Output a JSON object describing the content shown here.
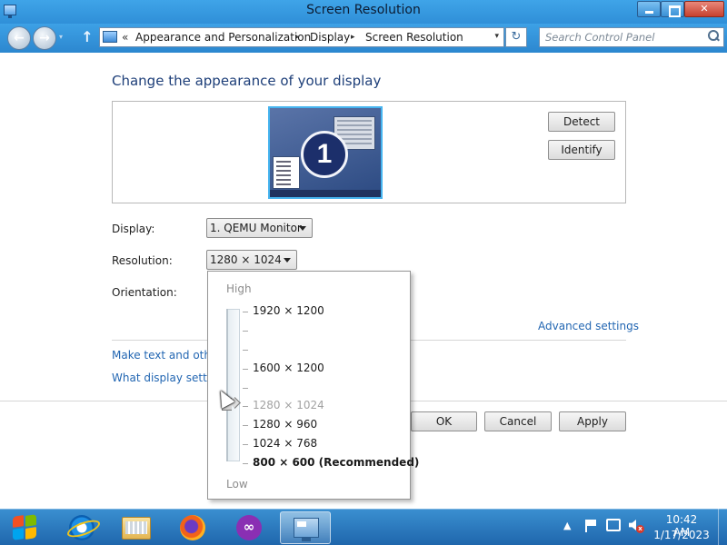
{
  "window": {
    "title": "Screen Resolution",
    "minimize": "",
    "maximize": "",
    "close": "✕"
  },
  "navigation": {
    "back": "←",
    "forward": "→",
    "up": "↑",
    "breadcrumb_lead": "«",
    "breadcrumb": [
      "Appearance and Personalization",
      "Display",
      "Screen Resolution"
    ],
    "breadcrumb_separator": "▸",
    "dropdown": "▾",
    "refresh": "↻",
    "search_placeholder": "Search Control Panel"
  },
  "content": {
    "page_title": "Change the appearance of your display",
    "monitor_number": "1",
    "detect_label": "Detect",
    "identify_label": "Identify",
    "display_label": "Display:",
    "display_value": "1. QEMU Monitor",
    "resolution_label": "Resolution:",
    "resolution_value": "1280 × 1024",
    "orientation_label": "Orientation:",
    "advanced_settings": "Advanced settings",
    "link_text_size": "Make text and other",
    "link_display_settings": "What display setting",
    "ok_label": "OK",
    "cancel_label": "Cancel",
    "apply_label": "Apply"
  },
  "resolution_dropdown": {
    "high_label": "High",
    "low_label": "Low",
    "options": [
      {
        "label": "1920 × 1200"
      },
      {
        "label": "1600 × 1200"
      },
      {
        "label": "1280 × 1024"
      },
      {
        "label": "1280 × 960"
      },
      {
        "label": "1024 × 768"
      },
      {
        "label": "800 × 600 (Recommended)"
      }
    ],
    "selected_index": 2
  },
  "taskbar": {
    "apps": [
      "start-icon",
      "internet-explorer-icon",
      "file-explorer-icon",
      "firefox-icon",
      "app-icon",
      "display-settings-icon"
    ],
    "tray_chevron": "▲",
    "volume_muted": "x",
    "clock_time": "10:42 AM",
    "clock_date": "1/17/2023"
  },
  "colors": {
    "title_bar": "#3fa4e8",
    "link": "#2266b2",
    "page_title": "#1e3f79",
    "taskbar": "#1f66ac"
  }
}
